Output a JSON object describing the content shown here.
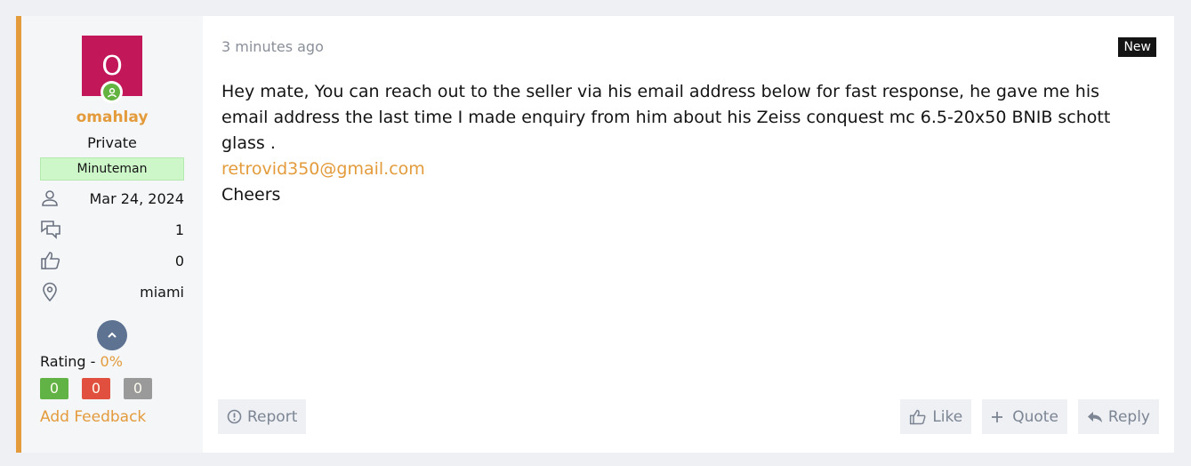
{
  "user": {
    "avatar_letter": "O",
    "avatar_color": "#c21859",
    "username": "omahlay",
    "title": "Private",
    "banner": "Minuteman",
    "stats": {
      "joined": "Mar 24, 2024",
      "messages": "1",
      "reactions": "0",
      "location": "miami"
    },
    "rating_label": "Rating - ",
    "rating_value": "0%",
    "feedback": {
      "positive": "0",
      "negative": "0",
      "neutral": "0"
    },
    "add_feedback": "Add Feedback"
  },
  "post": {
    "time": "3 minutes ago",
    "badge": "New",
    "line1": "Hey mate, You can reach out to the seller via his email address below for fast response, he gave me his email address the last time I made enquiry from him about his Zeiss conquest mc 6.5-20x50 BNIB schott glass .",
    "email": "retrovid350@gmail.com",
    "line3": "Cheers"
  },
  "actions": {
    "report": "Report",
    "like": "Like",
    "quote": "Quote",
    "reply": "Reply"
  },
  "colors": {
    "accent": "#e39b3c",
    "online": "#63b340",
    "positive": "#62b346",
    "negative": "#e1503f",
    "neutral": "#9a9a9a"
  }
}
